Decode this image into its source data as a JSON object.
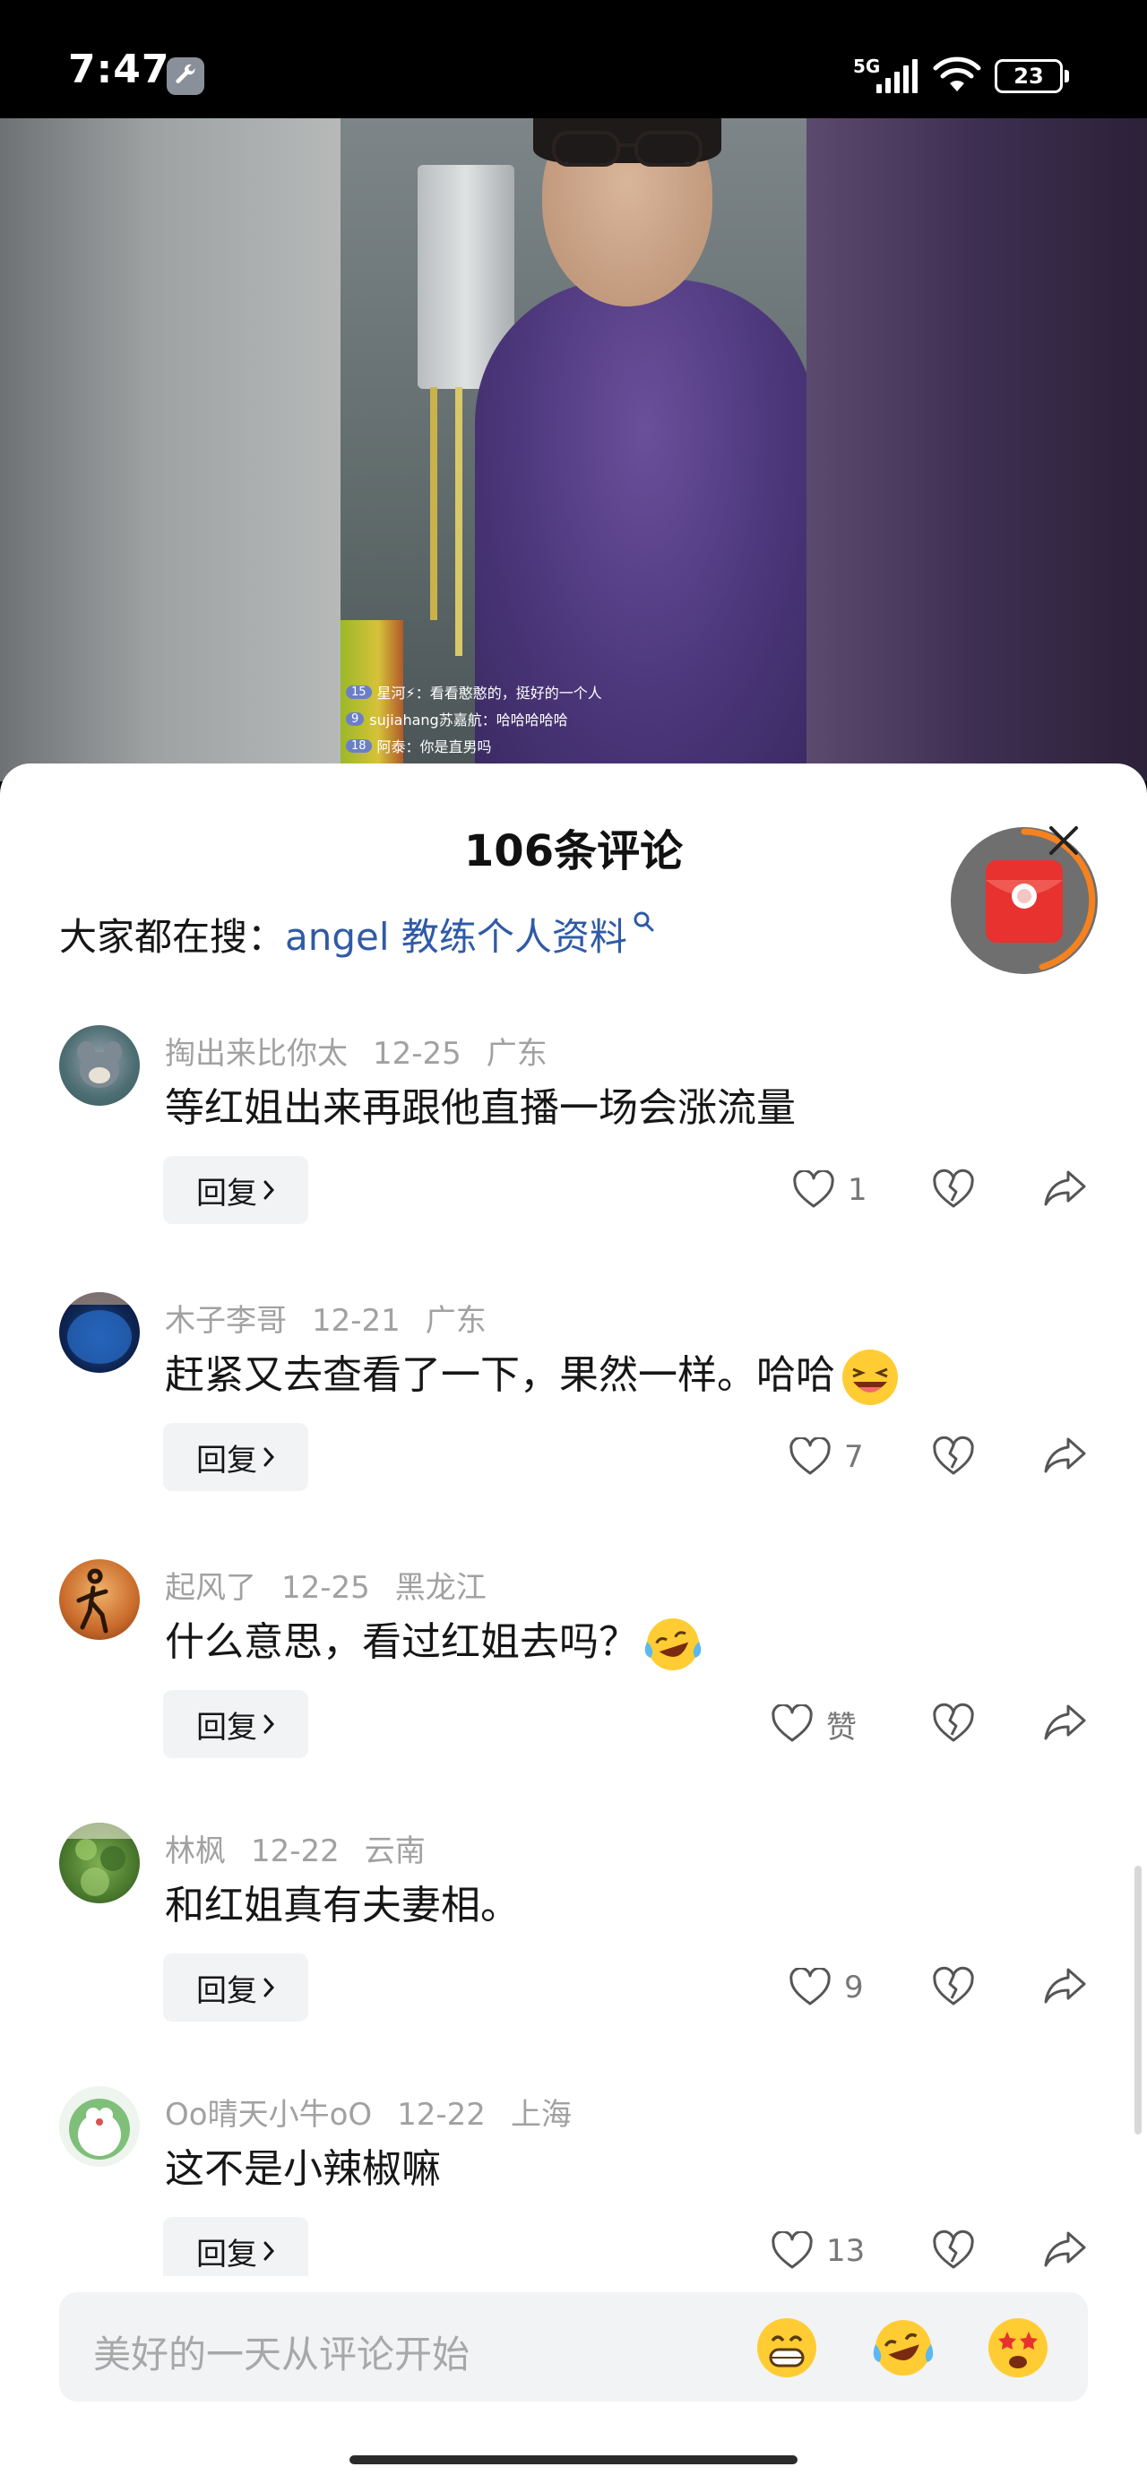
{
  "status_bar": {
    "time": "7:47",
    "network": "5G",
    "battery": "23"
  },
  "live_overlay": [
    {
      "badge": "15",
      "text": "星河⚡：看看憨憨的，挺好的一个人"
    },
    {
      "badge": "9",
      "text": "sujiahang苏嘉航：哈哈哈哈哈"
    },
    {
      "badge": "18",
      "text": "阿泰：你是直男吗"
    }
  ],
  "sheet": {
    "title": "106条评论",
    "search_prefix": "大家都在搜：",
    "search_link": "angel 教练个人资料"
  },
  "comments": [
    {
      "user": "掏出来比你太",
      "date": "12-25",
      "location": "广东",
      "text": "等红姐出来再跟他直播一场会涨流量",
      "reply_label": "回复",
      "likes": "1"
    },
    {
      "user": "木子李哥",
      "date": "12-21",
      "location": "广东",
      "text": "赶紧又去查看了一下，果然一样。哈哈",
      "reply_label": "回复",
      "likes": "7"
    },
    {
      "user": "起风了",
      "date": "12-25",
      "location": "黑龙江",
      "text": "什么意思，看过红姐去吗？",
      "reply_label": "回复",
      "likes": "赞"
    },
    {
      "user": "林枫",
      "date": "12-22",
      "location": "云南",
      "text": "和红姐真有夫妻相。",
      "reply_label": "回复",
      "likes": "9"
    },
    {
      "user": "Oo晴天小牛oO",
      "date": "12-22",
      "location": "上海",
      "text": "这不是小辣椒嘛",
      "reply_label": "回复",
      "likes": "13"
    }
  ],
  "input": {
    "placeholder": "美好的一天从评论开始"
  },
  "colors": {
    "link": "#2f5aa6",
    "meta": "#a1a1a1",
    "accent_orange": "#f5821f",
    "redpacket": "#e8322f"
  }
}
